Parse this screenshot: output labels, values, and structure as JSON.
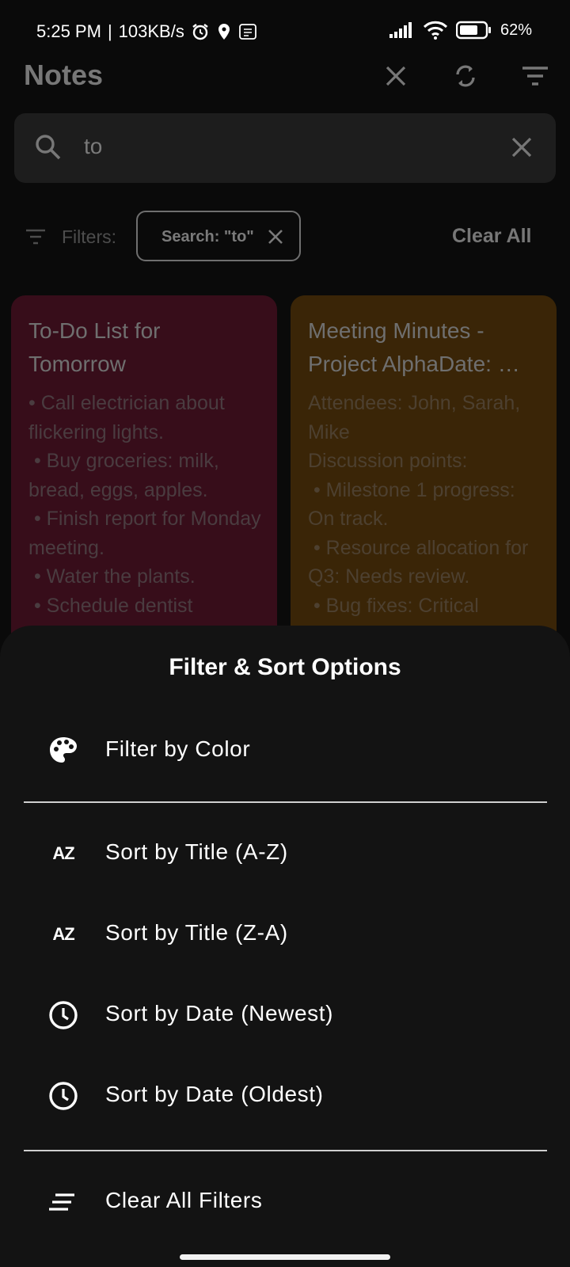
{
  "status_bar": {
    "time": "5:25 PM",
    "separator": "|",
    "network_speed": "103KB/s",
    "battery": "62%",
    "icons": [
      "alarm-icon",
      "location-icon",
      "app-icon",
      "signal-icon",
      "wifi-icon",
      "battery-icon"
    ]
  },
  "app_bar": {
    "title": "Notes",
    "icons": [
      "close-icon",
      "sync-icon",
      "filter-list-icon"
    ]
  },
  "search": {
    "value": "to",
    "icons": [
      "search-icon",
      "clear-icon"
    ]
  },
  "filters": {
    "label": "Filters:",
    "chip_label": "Search: \"to\"",
    "clear_all": "Clear All"
  },
  "notes": [
    {
      "title": "To-Do List for Tomorrow",
      "body": "• Call electrician about flickering lights.\n • Buy groceries: milk, bread, eggs, apples.\n • Finish report for Monday meeting.\n • Water the plants.\n • Schedule dentist",
      "color": "#370d1a"
    },
    {
      "title": "Meeting Minutes - Project AlphaDate: …",
      "body": "Attendees: John, Sarah, Mike\nDiscussion points:\n • Milestone 1 progress: On track.\n • Resource allocation for Q3: Needs review.\n • Bug fixes: Critical",
      "color": "#3a2507"
    }
  ],
  "sheet": {
    "title": "Filter & Sort Options",
    "options": [
      {
        "label": "Filter by Color",
        "icon": "palette-icon"
      },
      {
        "label": "Sort by Title (A-Z)",
        "icon": "sort-az-icon"
      },
      {
        "label": "Sort by Title (Z-A)",
        "icon": "sort-za-icon"
      },
      {
        "label": "Sort by Date (Newest)",
        "icon": "clock-icon"
      },
      {
        "label": "Sort by Date (Oldest)",
        "icon": "clock-icon"
      },
      {
        "label": "Clear All Filters",
        "icon": "clear-all-icon"
      }
    ],
    "az_glyph": "AZ"
  }
}
